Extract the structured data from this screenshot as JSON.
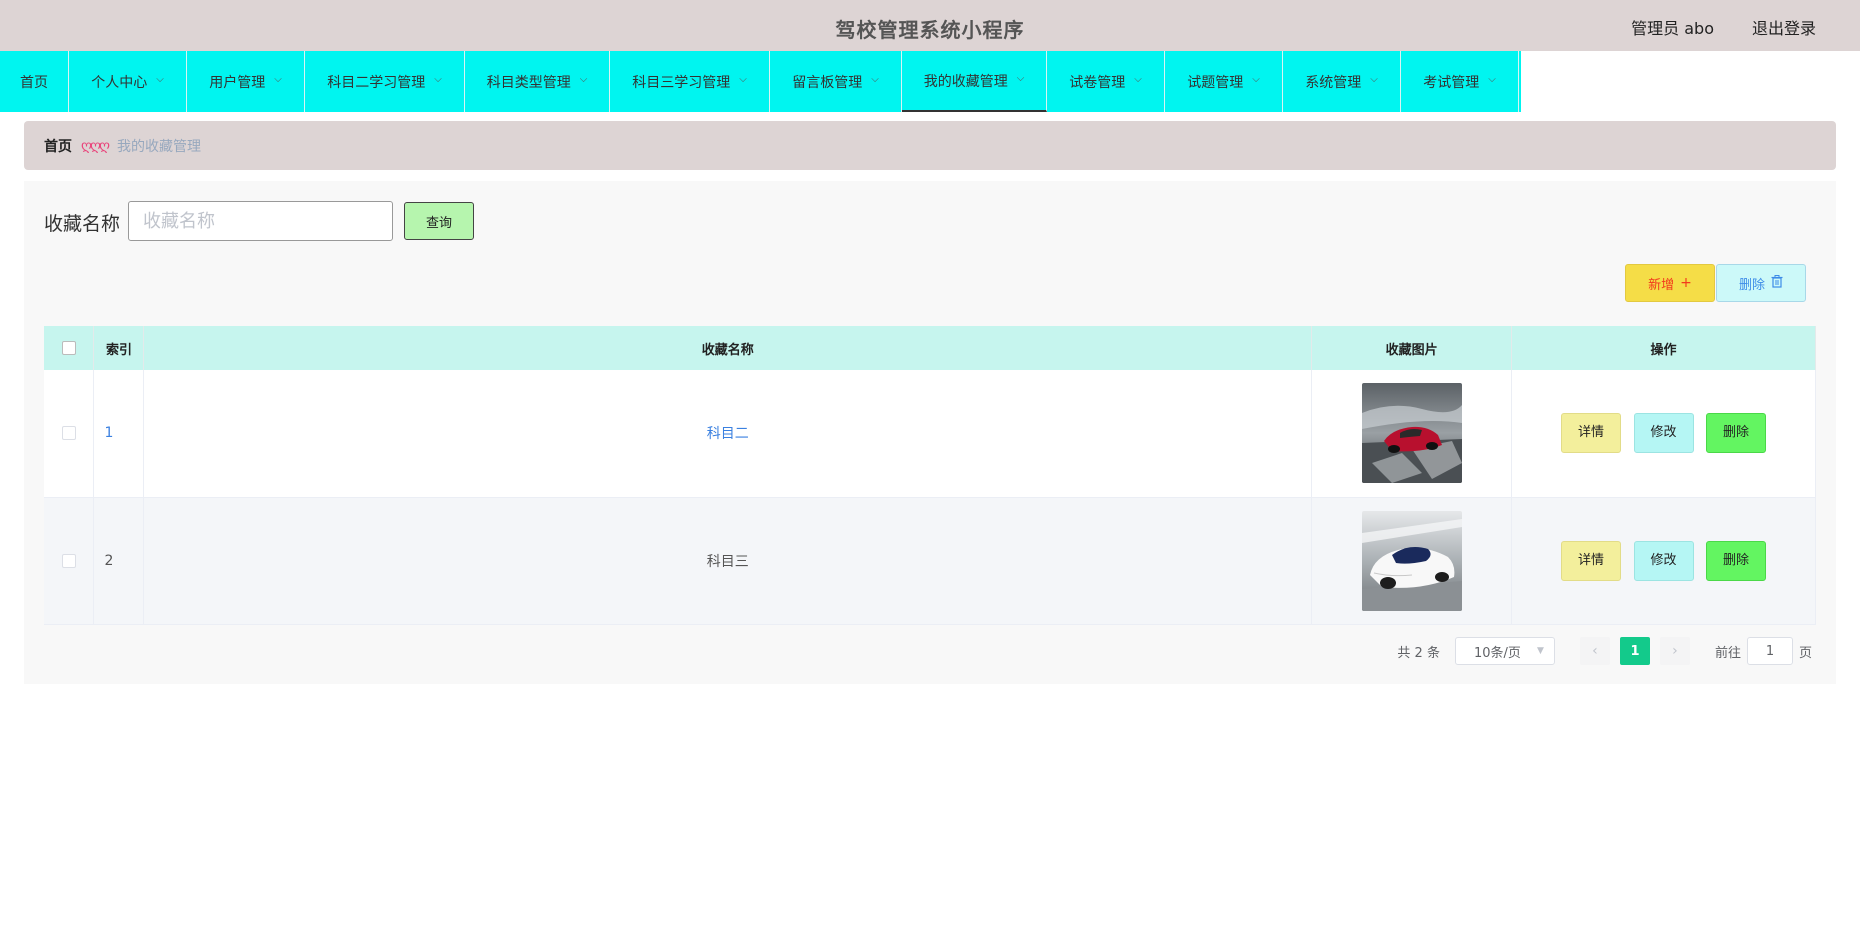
{
  "header": {
    "app_title": "驾校管理系统小程序",
    "user_info": "管理员 abo",
    "logout": "退出登录"
  },
  "nav": [
    {
      "label": "首页",
      "dropdown": false,
      "width": 69
    },
    {
      "label": "个人中心",
      "dropdown": true,
      "width": 118
    },
    {
      "label": "用户管理",
      "dropdown": true,
      "width": 118
    },
    {
      "label": "科目二学习管理",
      "dropdown": true,
      "width": 160
    },
    {
      "label": "科目类型管理",
      "dropdown": true,
      "width": 145
    },
    {
      "label": "科目三学习管理",
      "dropdown": true,
      "width": 160
    },
    {
      "label": "留言板管理",
      "dropdown": true,
      "width": 132
    },
    {
      "label": "我的收藏管理",
      "dropdown": true,
      "width": 145,
      "active": true
    },
    {
      "label": "试卷管理",
      "dropdown": true,
      "width": 118
    },
    {
      "label": "试题管理",
      "dropdown": true,
      "width": 118
    },
    {
      "label": "系统管理",
      "dropdown": true,
      "width": 118
    },
    {
      "label": "考试管理",
      "dropdown": true,
      "width": 118
    }
  ],
  "breadcrumb": {
    "home": "首页",
    "separator": "ღღღ",
    "current": "我的收藏管理"
  },
  "search": {
    "label": "收藏名称",
    "placeholder": "收藏名称",
    "button": "查询"
  },
  "actions": {
    "add": "新增",
    "delete": "删除"
  },
  "table": {
    "columns": [
      "索引",
      "收藏名称",
      "收藏图片",
      "操作"
    ],
    "rows": [
      {
        "index": "1",
        "name": "科目二",
        "image": "red-sports-car",
        "highlight": true
      },
      {
        "index": "2",
        "name": "科目三",
        "image": "white-sports-car",
        "highlight": false
      }
    ],
    "row_actions": {
      "detail": "详情",
      "edit": "修改",
      "delete": "删除"
    }
  },
  "pagination": {
    "total": "共 2 条",
    "page_size": "10条/页",
    "current_page": "1",
    "goto_prefix": "前往",
    "goto_value": "1",
    "goto_suffix": "页"
  },
  "colors": {
    "nav_bg": "#00f5f0",
    "header_bg": "#ddd4d4",
    "table_header_bg": "#c6f5ee",
    "pager_active": "#13ca8b"
  }
}
